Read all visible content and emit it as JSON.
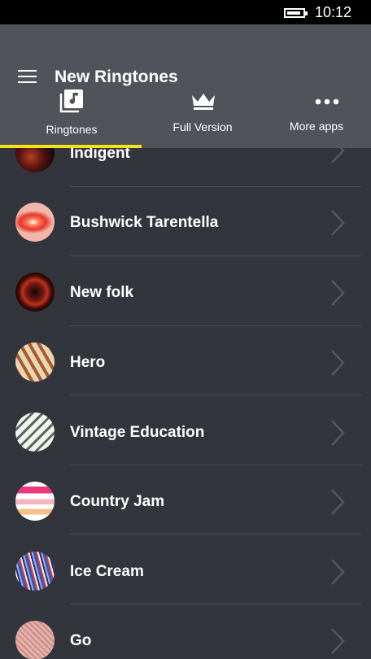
{
  "status": {
    "time": "10:12"
  },
  "header": {
    "title": "New Ringtones"
  },
  "tabs": [
    {
      "label": "Ringtones",
      "icon": "music-library-icon"
    },
    {
      "label": "Full Version",
      "icon": "crown-icon"
    },
    {
      "label": "More apps",
      "icon": "more-dots-icon"
    }
  ],
  "accent": "#f2e21a",
  "ringtones": [
    {
      "title": "Indigent"
    },
    {
      "title": "Bushwick Tarentella"
    },
    {
      "title": "New folk"
    },
    {
      "title": "Hero"
    },
    {
      "title": "Vintage Education"
    },
    {
      "title": "Country Jam"
    },
    {
      "title": "Ice Cream"
    },
    {
      "title": "Go"
    }
  ]
}
